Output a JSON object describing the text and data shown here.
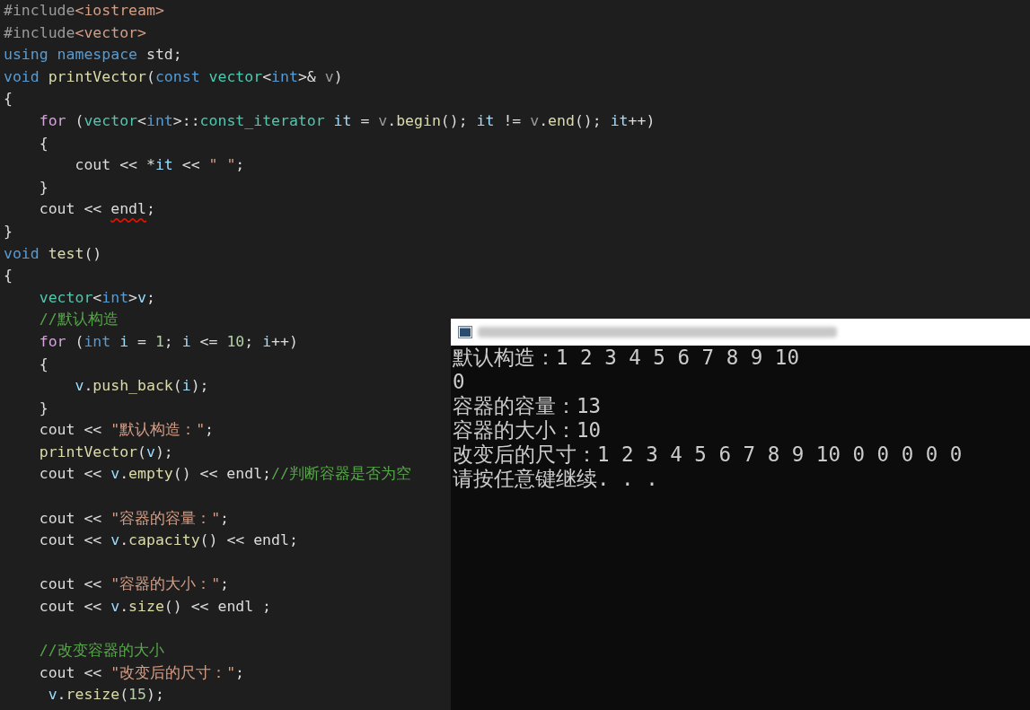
{
  "editor": {
    "lines": [
      {
        "kind": "code",
        "tokens": [
          {
            "kind": "preproc",
            "text": "#include"
          },
          {
            "kind": "string",
            "text": "<iostream>"
          }
        ]
      },
      {
        "kind": "code",
        "tokens": [
          {
            "kind": "preproc",
            "text": "#include"
          },
          {
            "kind": "string",
            "text": "<vector>"
          }
        ]
      },
      {
        "kind": "code",
        "tokens": [
          {
            "kind": "keyword",
            "text": "using"
          },
          {
            "kind": "keyword",
            "text": " namespace"
          },
          {
            "kind": "plain",
            "text": " std;"
          }
        ]
      },
      {
        "kind": "code",
        "tokens": [
          {
            "kind": "keyword",
            "text": "void"
          },
          {
            "kind": "func",
            "text": " printVector"
          },
          {
            "kind": "plain",
            "text": "("
          },
          {
            "kind": "keyword",
            "text": "const"
          },
          {
            "kind": "type",
            "text": " vector"
          },
          {
            "kind": "plain",
            "text": "<"
          },
          {
            "kind": "keyword",
            "text": "int"
          },
          {
            "kind": "plain",
            "text": ">& "
          },
          {
            "kind": "param",
            "text": "v"
          },
          {
            "kind": "plain",
            "text": ")"
          }
        ]
      },
      {
        "kind": "code",
        "tokens": [
          {
            "kind": "plain",
            "text": "{"
          }
        ]
      },
      {
        "kind": "code",
        "tokens": [
          {
            "kind": "control",
            "text": "    for"
          },
          {
            "kind": "plain",
            "text": " ("
          },
          {
            "kind": "type",
            "text": "vector"
          },
          {
            "kind": "plain",
            "text": "<"
          },
          {
            "kind": "keyword",
            "text": "int"
          },
          {
            "kind": "plain",
            "text": ">::"
          },
          {
            "kind": "type",
            "text": "const_iterator"
          },
          {
            "kind": "var",
            "text": " it"
          },
          {
            "kind": "plain",
            "text": " = "
          },
          {
            "kind": "param",
            "text": "v"
          },
          {
            "kind": "plain",
            "text": "."
          },
          {
            "kind": "func",
            "text": "begin"
          },
          {
            "kind": "plain",
            "text": "(); "
          },
          {
            "kind": "var",
            "text": "it"
          },
          {
            "kind": "plain",
            "text": " != "
          },
          {
            "kind": "param",
            "text": "v"
          },
          {
            "kind": "plain",
            "text": "."
          },
          {
            "kind": "func",
            "text": "end"
          },
          {
            "kind": "plain",
            "text": "(); "
          },
          {
            "kind": "var",
            "text": "it"
          },
          {
            "kind": "plain",
            "text": "++)"
          }
        ]
      },
      {
        "kind": "code",
        "tokens": [
          {
            "kind": "plain",
            "text": "    {"
          }
        ]
      },
      {
        "kind": "code",
        "tokens": [
          {
            "kind": "plain",
            "text": "        cout << *"
          },
          {
            "kind": "var",
            "text": "it"
          },
          {
            "kind": "plain",
            "text": " << "
          },
          {
            "kind": "string",
            "text": "\" \""
          },
          {
            "kind": "plain",
            "text": ";"
          }
        ]
      },
      {
        "kind": "code",
        "tokens": [
          {
            "kind": "plain",
            "text": "    }"
          }
        ]
      },
      {
        "kind": "code",
        "tokens": [
          {
            "kind": "plain",
            "text": "    cout << "
          },
          {
            "kind": "plain",
            "text": "endl",
            "error": true
          },
          {
            "kind": "plain",
            "text": ";"
          }
        ]
      },
      {
        "kind": "code",
        "tokens": [
          {
            "kind": "plain",
            "text": "}"
          }
        ]
      },
      {
        "kind": "code",
        "tokens": [
          {
            "kind": "keyword",
            "text": "void"
          },
          {
            "kind": "func",
            "text": " test"
          },
          {
            "kind": "plain",
            "text": "()"
          }
        ]
      },
      {
        "kind": "code",
        "tokens": [
          {
            "kind": "plain",
            "text": "{"
          }
        ]
      },
      {
        "kind": "code",
        "tokens": [
          {
            "kind": "type",
            "text": "    vector"
          },
          {
            "kind": "plain",
            "text": "<"
          },
          {
            "kind": "keyword",
            "text": "int"
          },
          {
            "kind": "plain",
            "text": ">"
          },
          {
            "kind": "var",
            "text": "v"
          },
          {
            "kind": "plain",
            "text": ";"
          }
        ]
      },
      {
        "kind": "code",
        "tokens": [
          {
            "kind": "comment",
            "text": "    //默认构造"
          }
        ]
      },
      {
        "kind": "code",
        "tokens": [
          {
            "kind": "control",
            "text": "    for"
          },
          {
            "kind": "plain",
            "text": " ("
          },
          {
            "kind": "keyword",
            "text": "int"
          },
          {
            "kind": "var",
            "text": " i"
          },
          {
            "kind": "plain",
            "text": " = "
          },
          {
            "kind": "number",
            "text": "1"
          },
          {
            "kind": "plain",
            "text": "; "
          },
          {
            "kind": "var",
            "text": "i"
          },
          {
            "kind": "plain",
            "text": " <= "
          },
          {
            "kind": "number",
            "text": "10"
          },
          {
            "kind": "plain",
            "text": "; "
          },
          {
            "kind": "var",
            "text": "i"
          },
          {
            "kind": "plain",
            "text": "++)"
          }
        ]
      },
      {
        "kind": "code",
        "tokens": [
          {
            "kind": "plain",
            "text": "    {"
          }
        ]
      },
      {
        "kind": "code",
        "tokens": [
          {
            "kind": "var",
            "text": "        v"
          },
          {
            "kind": "plain",
            "text": "."
          },
          {
            "kind": "func",
            "text": "push_back"
          },
          {
            "kind": "plain",
            "text": "("
          },
          {
            "kind": "var",
            "text": "i"
          },
          {
            "kind": "plain",
            "text": ");"
          }
        ]
      },
      {
        "kind": "code",
        "tokens": [
          {
            "kind": "plain",
            "text": "    }"
          }
        ]
      },
      {
        "kind": "code",
        "tokens": [
          {
            "kind": "plain",
            "text": "    cout << "
          },
          {
            "kind": "string",
            "text": "\"默认构造：\""
          },
          {
            "kind": "plain",
            "text": ";"
          }
        ]
      },
      {
        "kind": "code",
        "tokens": [
          {
            "kind": "func",
            "text": "    printVector"
          },
          {
            "kind": "plain",
            "text": "("
          },
          {
            "kind": "var",
            "text": "v"
          },
          {
            "kind": "plain",
            "text": ");"
          }
        ]
      },
      {
        "kind": "code",
        "tokens": [
          {
            "kind": "plain",
            "text": "    cout << "
          },
          {
            "kind": "var",
            "text": "v"
          },
          {
            "kind": "plain",
            "text": "."
          },
          {
            "kind": "func",
            "text": "empty"
          },
          {
            "kind": "plain",
            "text": "() << endl;"
          },
          {
            "kind": "comment",
            "text": "//判断容器是否为空"
          }
        ]
      },
      {
        "kind": "blank"
      },
      {
        "kind": "code",
        "tokens": [
          {
            "kind": "plain",
            "text": "    cout << "
          },
          {
            "kind": "string",
            "text": "\"容器的容量：\""
          },
          {
            "kind": "plain",
            "text": ";"
          }
        ]
      },
      {
        "kind": "code",
        "tokens": [
          {
            "kind": "plain",
            "text": "    cout << "
          },
          {
            "kind": "var",
            "text": "v"
          },
          {
            "kind": "plain",
            "text": "."
          },
          {
            "kind": "func",
            "text": "capacity"
          },
          {
            "kind": "plain",
            "text": "() << endl;"
          }
        ]
      },
      {
        "kind": "blank"
      },
      {
        "kind": "code",
        "tokens": [
          {
            "kind": "plain",
            "text": "    cout << "
          },
          {
            "kind": "string",
            "text": "\"容器的大小：\""
          },
          {
            "kind": "plain",
            "text": ";"
          }
        ]
      },
      {
        "kind": "code",
        "tokens": [
          {
            "kind": "plain",
            "text": "    cout << "
          },
          {
            "kind": "var",
            "text": "v"
          },
          {
            "kind": "plain",
            "text": "."
          },
          {
            "kind": "func",
            "text": "size"
          },
          {
            "kind": "plain",
            "text": "() << endl ;"
          }
        ]
      },
      {
        "kind": "blank"
      },
      {
        "kind": "code",
        "tokens": [
          {
            "kind": "comment",
            "text": "    //改变容器的大小"
          }
        ]
      },
      {
        "kind": "code",
        "tokens": [
          {
            "kind": "plain",
            "text": "    cout << "
          },
          {
            "kind": "string",
            "text": "\"改变后的尺寸：\""
          },
          {
            "kind": "plain",
            "text": ";"
          }
        ]
      },
      {
        "kind": "code",
        "tokens": [
          {
            "kind": "var",
            "text": "     v"
          },
          {
            "kind": "plain",
            "text": "."
          },
          {
            "kind": "func",
            "text": "resize"
          },
          {
            "kind": "plain",
            "text": "("
          },
          {
            "kind": "number",
            "text": "15"
          },
          {
            "kind": "plain",
            "text": ");"
          }
        ]
      }
    ]
  },
  "console": {
    "output": [
      "默认构造：1 2 3 4 5 6 7 8 9 10",
      "0",
      "容器的容量：13",
      "容器的大小：10",
      "改变后的尺寸：1 2 3 4 5 6 7 8 9 10 0 0 0 0 0",
      "请按任意键继续. . ."
    ]
  }
}
